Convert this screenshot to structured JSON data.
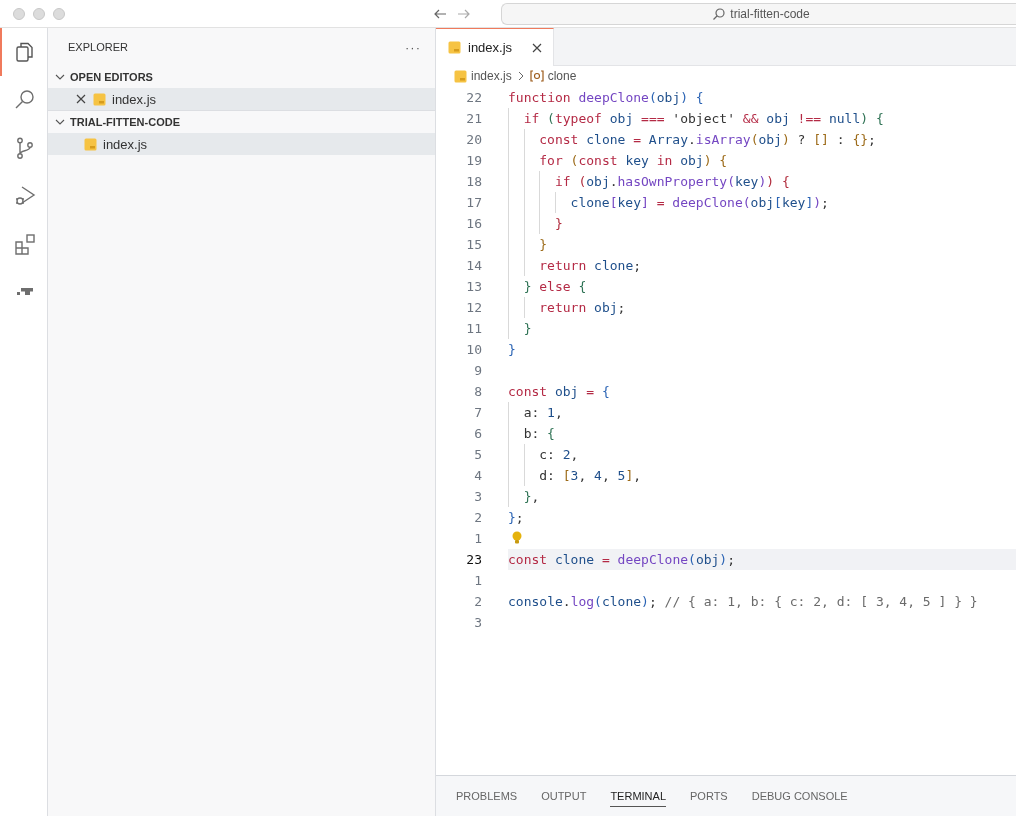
{
  "titlebar": {
    "search": "trial-fitten-code"
  },
  "activity_bar": [
    {
      "kind": "files",
      "selected": true
    },
    {
      "kind": "search",
      "selected": false
    },
    {
      "kind": "branch",
      "selected": false
    },
    {
      "kind": "debug",
      "selected": false
    },
    {
      "kind": "extensions",
      "selected": false
    },
    {
      "kind": "blocks",
      "selected": false
    }
  ],
  "explorer": {
    "title": "EXPLORER",
    "more": "···",
    "sections": [
      {
        "title": "OPEN EDITORS",
        "expanded": true,
        "items": [
          {
            "label": "index.js",
            "closable": true,
            "selected": true
          }
        ]
      },
      {
        "title": "TRIAL-FITTEN-CODE",
        "expanded": true,
        "items": [
          {
            "label": "index.js",
            "closable": false,
            "selected": true
          }
        ]
      }
    ]
  },
  "editor": {
    "tabs": [
      {
        "label": "index.js",
        "selected": true
      }
    ],
    "breadcrumbs": [
      {
        "kind": "file",
        "label": "index.js"
      },
      {
        "kind": "variable",
        "label": "clone"
      }
    ],
    "lines": [
      {
        "number": "22",
        "current": false,
        "tokens": [
          {
            "kind": "kw",
            "text": "function"
          },
          {
            "kind": "fn",
            "text": " deepClone"
          },
          {
            "kind": "b1",
            "text": "("
          },
          {
            "kind": "id",
            "text": "obj"
          },
          {
            "kind": "b1",
            "text": ")"
          },
          {
            "kind": "b1",
            "text": " {"
          }
        ]
      },
      {
        "number": "21",
        "current": false,
        "tokens": [
          {
            "kind": "kw",
            "text": "  if"
          },
          {
            "kind": "b2",
            "text": " ("
          },
          {
            "kind": "kw",
            "text": "typeof"
          },
          {
            "kind": "id",
            "text": " obj"
          },
          {
            "kind": "op",
            "text": " ==="
          },
          {
            "kind": "str",
            "text": " 'object'"
          },
          {
            "kind": "op",
            "text": " &&"
          },
          {
            "kind": "id",
            "text": " obj"
          },
          {
            "kind": "op",
            "text": " !=="
          },
          {
            "kind": "id",
            "text": " null"
          },
          {
            "kind": "b2",
            "text": ")"
          },
          {
            "kind": "b2",
            "text": " {"
          }
        ]
      },
      {
        "number": "20",
        "current": false,
        "tokens": [
          {
            "kind": "kw",
            "text": "    const"
          },
          {
            "kind": "id",
            "text": " clone"
          },
          {
            "kind": "op",
            "text": " ="
          },
          {
            "kind": "id",
            "text": " Array"
          },
          {
            "kind": "p",
            "text": "."
          },
          {
            "kind": "fn",
            "text": "isArray"
          },
          {
            "kind": "b3",
            "text": "("
          },
          {
            "kind": "id",
            "text": "obj"
          },
          {
            "kind": "b3",
            "text": ")"
          },
          {
            "kind": "p",
            "text": " ?"
          },
          {
            "kind": "b3",
            "text": " []"
          },
          {
            "kind": "p",
            "text": " :"
          },
          {
            "kind": "b3",
            "text": " {}"
          },
          {
            "kind": "p",
            "text": ";"
          }
        ]
      },
      {
        "number": "19",
        "current": false,
        "tokens": [
          {
            "kind": "kw",
            "text": "    for"
          },
          {
            "kind": "b3",
            "text": " ("
          },
          {
            "kind": "kw",
            "text": "const"
          },
          {
            "kind": "id",
            "text": " key"
          },
          {
            "kind": "kw",
            "text": " in"
          },
          {
            "kind": "id",
            "text": " obj"
          },
          {
            "kind": "b3",
            "text": ")"
          },
          {
            "kind": "b3",
            "text": " {"
          }
        ]
      },
      {
        "number": "18",
        "current": false,
        "tokens": [
          {
            "kind": "kw",
            "text": "      if"
          },
          {
            "kind": "b4",
            "text": " ("
          },
          {
            "kind": "id",
            "text": "obj"
          },
          {
            "kind": "p",
            "text": "."
          },
          {
            "kind": "fn",
            "text": "hasOwnProperty"
          },
          {
            "kind": "b5",
            "text": "("
          },
          {
            "kind": "id",
            "text": "key"
          },
          {
            "kind": "b5",
            "text": ")"
          },
          {
            "kind": "b4",
            "text": ")"
          },
          {
            "kind": "b4",
            "text": " {"
          }
        ]
      },
      {
        "number": "17",
        "current": false,
        "tokens": [
          {
            "kind": "id",
            "text": "        clone"
          },
          {
            "kind": "b5",
            "text": "["
          },
          {
            "kind": "id",
            "text": "key"
          },
          {
            "kind": "b5",
            "text": "]"
          },
          {
            "kind": "op",
            "text": " ="
          },
          {
            "kind": "fn",
            "text": " deepClone"
          },
          {
            "kind": "b5",
            "text": "("
          },
          {
            "kind": "id",
            "text": "obj"
          },
          {
            "kind": "b1",
            "text": "["
          },
          {
            "kind": "id",
            "text": "key"
          },
          {
            "kind": "b1",
            "text": "]"
          },
          {
            "kind": "b5",
            "text": ")"
          },
          {
            "kind": "p",
            "text": ";"
          }
        ]
      },
      {
        "number": "16",
        "current": false,
        "tokens": [
          {
            "kind": "b4",
            "text": "      }"
          }
        ]
      },
      {
        "number": "15",
        "current": false,
        "tokens": [
          {
            "kind": "b3",
            "text": "    }"
          }
        ]
      },
      {
        "number": "14",
        "current": false,
        "tokens": [
          {
            "kind": "kw",
            "text": "    return"
          },
          {
            "kind": "id",
            "text": " clone"
          },
          {
            "kind": "p",
            "text": ";"
          }
        ]
      },
      {
        "number": "13",
        "current": false,
        "tokens": [
          {
            "kind": "b2",
            "text": "  }"
          },
          {
            "kind": "kw",
            "text": " else"
          },
          {
            "kind": "b2",
            "text": " {"
          }
        ]
      },
      {
        "number": "12",
        "current": false,
        "tokens": [
          {
            "kind": "kw",
            "text": "    return"
          },
          {
            "kind": "id",
            "text": " obj"
          },
          {
            "kind": "p",
            "text": ";"
          }
        ]
      },
      {
        "number": "11",
        "current": false,
        "tokens": [
          {
            "kind": "b2",
            "text": "  }"
          }
        ]
      },
      {
        "number": "10",
        "current": false,
        "tokens": [
          {
            "kind": "b1",
            "text": "}"
          }
        ]
      },
      {
        "number": "9",
        "current": false
      },
      {
        "number": "8",
        "current": false,
        "tokens": [
          {
            "kind": "kw",
            "text": "const"
          },
          {
            "kind": "id",
            "text": " obj"
          },
          {
            "kind": "op",
            "text": " ="
          },
          {
            "kind": "b1",
            "text": " {"
          }
        ]
      },
      {
        "number": "7",
        "current": false,
        "tokens": [
          {
            "kind": "p",
            "text": "  a:"
          },
          {
            "kind": "num",
            "text": " 1"
          },
          {
            "kind": "p",
            "text": ","
          }
        ]
      },
      {
        "number": "6",
        "current": false,
        "tokens": [
          {
            "kind": "p",
            "text": "  b:"
          },
          {
            "kind": "b2",
            "text": " {"
          }
        ]
      },
      {
        "number": "5",
        "current": false,
        "tokens": [
          {
            "kind": "p",
            "text": "    c:"
          },
          {
            "kind": "num",
            "text": " 2"
          },
          {
            "kind": "p",
            "text": ","
          }
        ]
      },
      {
        "number": "4",
        "current": false,
        "tokens": [
          {
            "kind": "p",
            "text": "    d:"
          },
          {
            "kind": "b3",
            "text": " ["
          },
          {
            "kind": "num",
            "text": "3"
          },
          {
            "kind": "p",
            "text": ","
          },
          {
            "kind": "num",
            "text": " 4"
          },
          {
            "kind": "p",
            "text": ","
          },
          {
            "kind": "num",
            "text": " 5"
          },
          {
            "kind": "b3",
            "text": "]"
          },
          {
            "kind": "p",
            "text": ","
          }
        ]
      },
      {
        "number": "3",
        "current": false,
        "tokens": [
          {
            "kind": "b2",
            "text": "  }"
          },
          {
            "kind": "p",
            "text": ","
          }
        ]
      },
      {
        "number": "2",
        "current": false,
        "tokens": [
          {
            "kind": "b1",
            "text": "}"
          },
          {
            "kind": "p",
            "text": ";"
          }
        ]
      },
      {
        "number": "1",
        "current": false,
        "lightbulb": true
      },
      {
        "number": "23",
        "current": true,
        "tokens": [
          {
            "kind": "kw",
            "text": "const"
          },
          {
            "kind": "id",
            "text": " clone"
          },
          {
            "kind": "op",
            "text": " ="
          },
          {
            "kind": "fn",
            "text": " deepClone"
          },
          {
            "kind": "b1",
            "text": "("
          },
          {
            "kind": "id",
            "text": "obj"
          },
          {
            "kind": "b1",
            "text": ")"
          },
          {
            "kind": "p",
            "text": ";"
          }
        ]
      },
      {
        "number": "1",
        "current": false
      },
      {
        "number": "2",
        "current": false,
        "tokens": [
          {
            "kind": "id",
            "text": "console"
          },
          {
            "kind": "p",
            "text": "."
          },
          {
            "kind": "fn",
            "text": "log"
          },
          {
            "kind": "b1",
            "text": "("
          },
          {
            "kind": "id",
            "text": "clone"
          },
          {
            "kind": "b1",
            "text": ")"
          },
          {
            "kind": "p",
            "text": ";"
          },
          {
            "kind": "cm",
            "text": " // { a: 1, b: { c: 2, d: [ 3, 4, 5 ] } }"
          }
        ]
      },
      {
        "number": "3",
        "current": false
      }
    ]
  },
  "panel": {
    "tabs": [
      {
        "label": "PROBLEMS",
        "selected": false
      },
      {
        "label": "OUTPUT",
        "selected": false
      },
      {
        "label": "TERMINAL",
        "selected": true
      },
      {
        "label": "PORTS",
        "selected": false
      },
      {
        "label": "DEBUG CONSOLE",
        "selected": false
      }
    ]
  }
}
